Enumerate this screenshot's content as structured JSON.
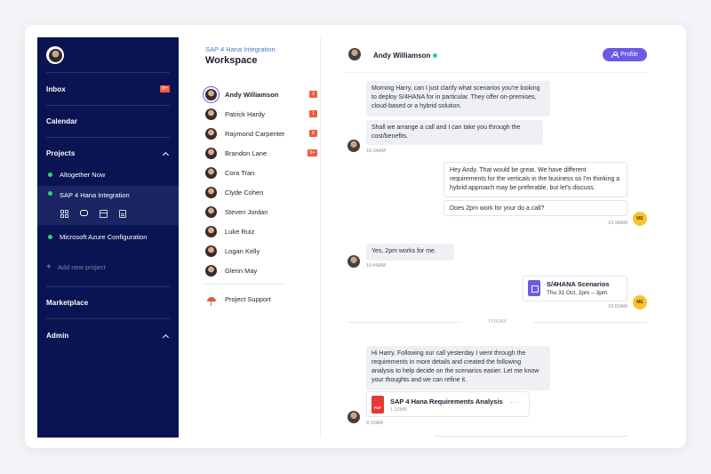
{
  "sidebar": {
    "inbox": {
      "label": "Inbox",
      "badge": "9+"
    },
    "calendar": {
      "label": "Calendar"
    },
    "projects": {
      "label": "Projects",
      "items": [
        {
          "label": "Altogether Now"
        },
        {
          "label": "SAP 4 Hana Integration"
        },
        {
          "label": "Microsoft Azure Configuration"
        }
      ],
      "add_label": "Add new project"
    },
    "marketplace": {
      "label": "Marketplace"
    },
    "admin": {
      "label": "Admin"
    }
  },
  "workspace": {
    "subtitle": "SAP 4 Hana Integration",
    "title": "Workspace",
    "contacts": [
      {
        "name": "Andy Williamson",
        "badge": "2"
      },
      {
        "name": "Patrick Hardy",
        "badge": "1"
      },
      {
        "name": "Raymond Carpenter",
        "badge": "6"
      },
      {
        "name": "Brandon Lane",
        "badge": "9+"
      },
      {
        "name": "Cora Tran",
        "badge": ""
      },
      {
        "name": "Clyde Cohen",
        "badge": ""
      },
      {
        "name": "Steven Jordan",
        "badge": ""
      },
      {
        "name": "Luke Ruiz",
        "badge": ""
      },
      {
        "name": "Logan Kelly",
        "badge": ""
      },
      {
        "name": "Glenn May",
        "badge": ""
      }
    ],
    "support": "Project Support"
  },
  "chat": {
    "contact_name": "Andy Williamson",
    "profile_button": "Profile",
    "messages": {
      "m1": "Morning Harry, can I just clarify what scenarios you're looking to deploy S/4HANA for in particular. They offer on-premises, cloud-based or a hybrid solution.",
      "m2": "Shall we arrange a call and I can take you through the cost/benefits.",
      "t1": "10:34AM",
      "m3": "Hey Andy. That would be great. We have different requirements for the verticals in the business so I'm thinking a hybrid approach may be preferable, but let's discuss.",
      "m4": "Does 2pm work for your do a call?",
      "t2": "10:38AM",
      "m5": "Yes, 2pm works for me.",
      "t3": "10:45AM",
      "event_title": "S/4HANA Scenarios",
      "event_time": "Thu 31 Oct, 2pm – 3pm",
      "t4": "10:52AM",
      "divider": "TODAY",
      "m6": "Hi Harry. Following our call yesterday I went through the requirements in more details and created the following analysis to help decide on the scenarios easier. Let me know your thoughts and we can refine it.",
      "file_badge": "PDF",
      "file_title": "SAP 4 Hana Requirements Analysis",
      "file_size": "1.32MB",
      "t5": "9:10AM"
    },
    "me_initials": "ME",
    "more_glyph": "···"
  },
  "colors": {
    "sidebar_bg": "#0b1452",
    "accent": "#6a5ae6",
    "badge": "#ef5b3f",
    "online": "#2fd07f",
    "me": "#f7c52a"
  }
}
